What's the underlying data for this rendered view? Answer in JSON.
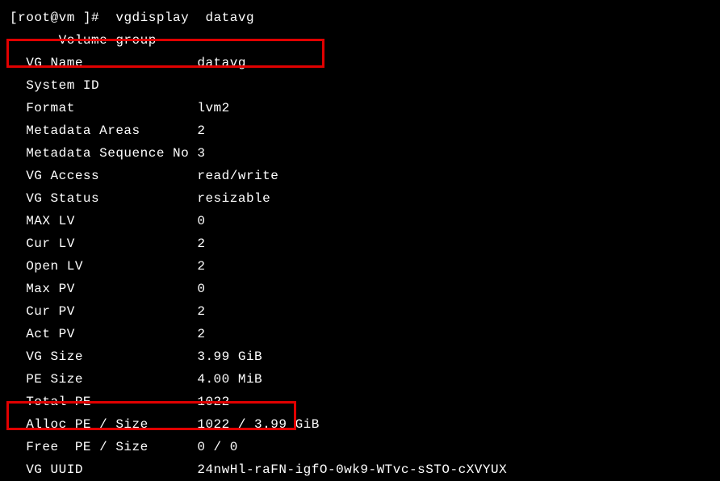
{
  "prompt_user": "root@vm ",
  "prompt_command": "vgdisplay  datavg",
  "header": "  --- Volume group ---",
  "rows": [
    {
      "label": "  VG Name              ",
      "value": "datavg"
    },
    {
      "label": "  System ID            ",
      "value": ""
    },
    {
      "label": "  Format               ",
      "value": "lvm2"
    },
    {
      "label": "  Metadata Areas       ",
      "value": "2"
    },
    {
      "label": "  Metadata Sequence No ",
      "value": "3"
    },
    {
      "label": "  VG Access            ",
      "value": "read/write"
    },
    {
      "label": "  VG Status            ",
      "value": "resizable"
    },
    {
      "label": "  MAX LV               ",
      "value": "0"
    },
    {
      "label": "  Cur LV               ",
      "value": "2"
    },
    {
      "label": "  Open LV              ",
      "value": "2"
    },
    {
      "label": "  Max PV               ",
      "value": "0"
    },
    {
      "label": "  Cur PV               ",
      "value": "2"
    },
    {
      "label": "  Act PV               ",
      "value": "2"
    },
    {
      "label": "  VG Size              ",
      "value": "3.99 GiB"
    },
    {
      "label": "  PE Size              ",
      "value": "4.00 MiB"
    },
    {
      "label": "  Total PE             ",
      "value": "1022"
    },
    {
      "label": "  Alloc PE / Size      ",
      "value": "1022 / 3.99 GiB"
    },
    {
      "label": "  Free  PE / Size      ",
      "value": "0 / 0"
    },
    {
      "label": "  VG UUID              ",
      "value": "24nwHl-raFN-igfO-0wk9-WTvc-sSTO-cXVYUX"
    }
  ]
}
